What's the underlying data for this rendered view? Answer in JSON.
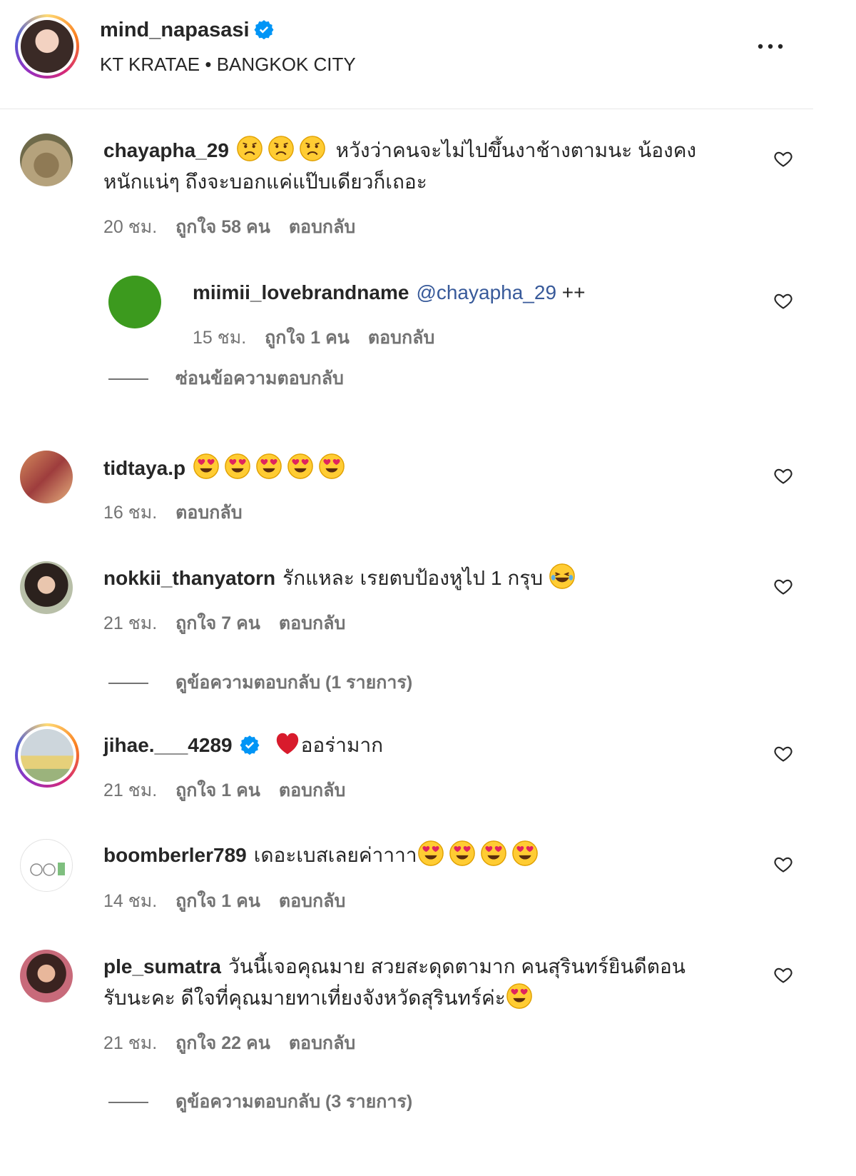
{
  "post": {
    "username": "mind_napasasi",
    "location": "KT KRATAE • BANGKOK CITY"
  },
  "comments": [
    {
      "username": "chayapha_29",
      "text_line1": "หวังว่าคนจะไม่ไปขึ้นงาช้างตามนะ น้องคง",
      "text_line2": "หนักแน่ๆ ถึงจะบอกแค่แป๊บเดียวก็เถอะ",
      "emoji": "sad-emoji",
      "time": "20 ชม.",
      "likes": "ถูกใจ 58 คน",
      "reply": "ตอบกลับ"
    },
    {
      "username": "miimii_lovebrandname",
      "mention": "@chayapha_29",
      "text": "++",
      "time": "15 ชม.",
      "likes": "ถูกใจ 1 คน",
      "reply": "ตอบกลับ",
      "thread": "ซ่อนข้อความตอบกลับ"
    },
    {
      "username": "tidtaya.p",
      "emoji": "heart-eyes-emoji",
      "time": "16 ชม.",
      "reply": "ตอบกลับ"
    },
    {
      "username": "nokkii_thanyatorn",
      "text": "รักแหละ เรยตบป้องหูไป 1 กรุบ",
      "emoji": "laughing-emoji",
      "time": "21 ชม.",
      "likes": "ถูกใจ 7 คน",
      "reply": "ตอบกลับ",
      "thread": "ดูข้อความตอบกลับ (1 รายการ)"
    },
    {
      "username": "jihae.___4289",
      "text": "ออร่ามาก",
      "emoji": "red-heart-emoji",
      "time": "21 ชม.",
      "likes": "ถูกใจ 1 คน",
      "reply": "ตอบกลับ"
    },
    {
      "username": "boomberler789",
      "text": "เดอะเบสเลยค่าาาา",
      "emoji": "heart-eyes-emoji",
      "time": "14 ชม.",
      "likes": "ถูกใจ 1 คน",
      "reply": "ตอบกลับ"
    },
    {
      "username": "ple_sumatra",
      "text_line1": "วันนี้เจอคุณมาย สวยสะดุดตามาก คนสุรินทร์ยินดีตอน",
      "text_line2": "รับนะคะ ดีใจที่คุณมายทาเที่ยงจังหวัดสุรินทร์ค่ะ",
      "emoji": "heart-eyes-emoji",
      "time": "21 ชม.",
      "likes": "ถูกใจ 22 คน",
      "reply": "ตอบกลับ",
      "thread": "ดูข้อความตอบกลับ (3 รายการ)"
    }
  ],
  "colors": {
    "text": "#262626",
    "meta": "#737373",
    "mention": "#385a9a",
    "verified": "#0095f6"
  }
}
